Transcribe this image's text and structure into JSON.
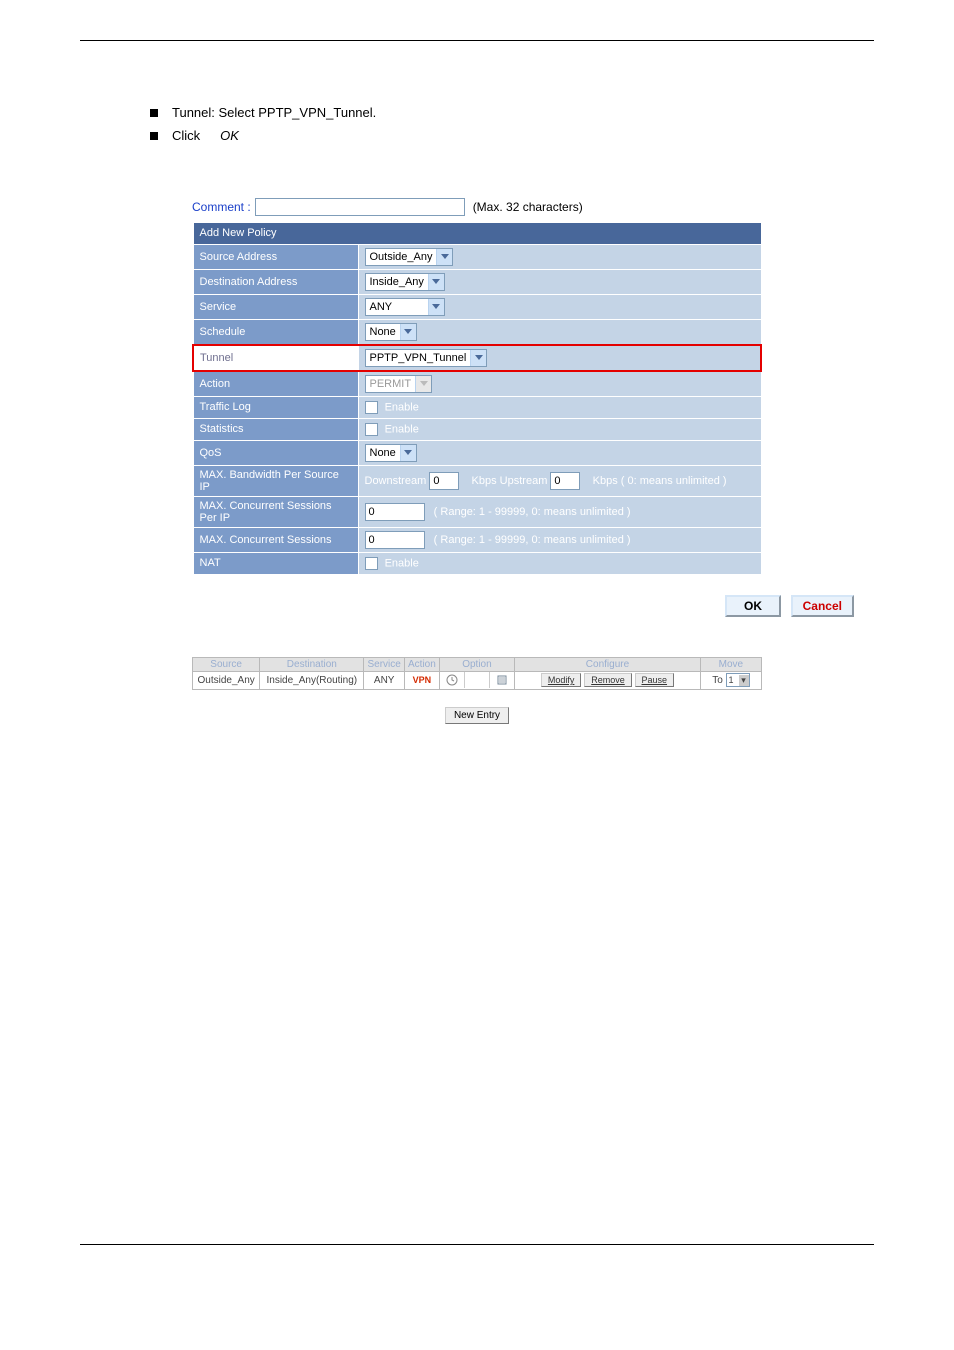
{
  "bullets": {
    "b1": "Tunnel: Select PPTP_VPN_Tunnel.",
    "b2_pre": "Click",
    "b2_em": "OK"
  },
  "form": {
    "comment_label": "Comment :",
    "comment_hint": "(Max. 32 characters)",
    "header": "Add New Policy",
    "rows": {
      "source": {
        "label": "Source Address",
        "value": "Outside_Any"
      },
      "dest": {
        "label": "Destination Address",
        "value": "Inside_Any"
      },
      "service": {
        "label": "Service",
        "value": "ANY"
      },
      "schedule": {
        "label": "Schedule",
        "value": "None"
      },
      "tunnel": {
        "label": "Tunnel",
        "value": "PPTP_VPN_Tunnel"
      },
      "action": {
        "label": "Action",
        "value": "PERMIT"
      },
      "traffic": {
        "label": "Traffic Log",
        "value": "Enable"
      },
      "stats": {
        "label": "Statistics",
        "value": "Enable"
      },
      "qos": {
        "label": "QoS",
        "value": "None"
      },
      "bw": {
        "label": "MAX. Bandwidth Per Source IP",
        "down_lbl": "Downstream",
        "down_val": "0",
        "up_lbl": "Kbps Upstream",
        "up_val": "0",
        "note": "Kbps ( 0: means unlimited )"
      },
      "sess_ip": {
        "label": "MAX. Concurrent Sessions Per IP",
        "value": "0",
        "note": "( Range: 1 - 99999, 0: means unlimited )"
      },
      "sess": {
        "label": "MAX. Concurrent Sessions",
        "value": "0",
        "note": "( Range: 1 - 99999, 0: means unlimited )"
      },
      "nat": {
        "label": "NAT",
        "value": "Enable"
      }
    },
    "buttons": {
      "ok": "OK",
      "cancel": "Cancel"
    }
  },
  "list": {
    "headers": {
      "source": "Source",
      "dest": "Destination",
      "service": "Service",
      "action": "Action",
      "option": "Option",
      "configure": "Configure",
      "move": "Move"
    },
    "row": {
      "source": "Outside_Any",
      "dest": "Inside_Any(Routing)",
      "service": "ANY",
      "action": "VPN",
      "conf_modify": "Modify",
      "conf_remove": "Remove",
      "conf_pause": "Pause",
      "move_to": "To",
      "move_val": "1"
    },
    "new_entry": "New Entry"
  }
}
